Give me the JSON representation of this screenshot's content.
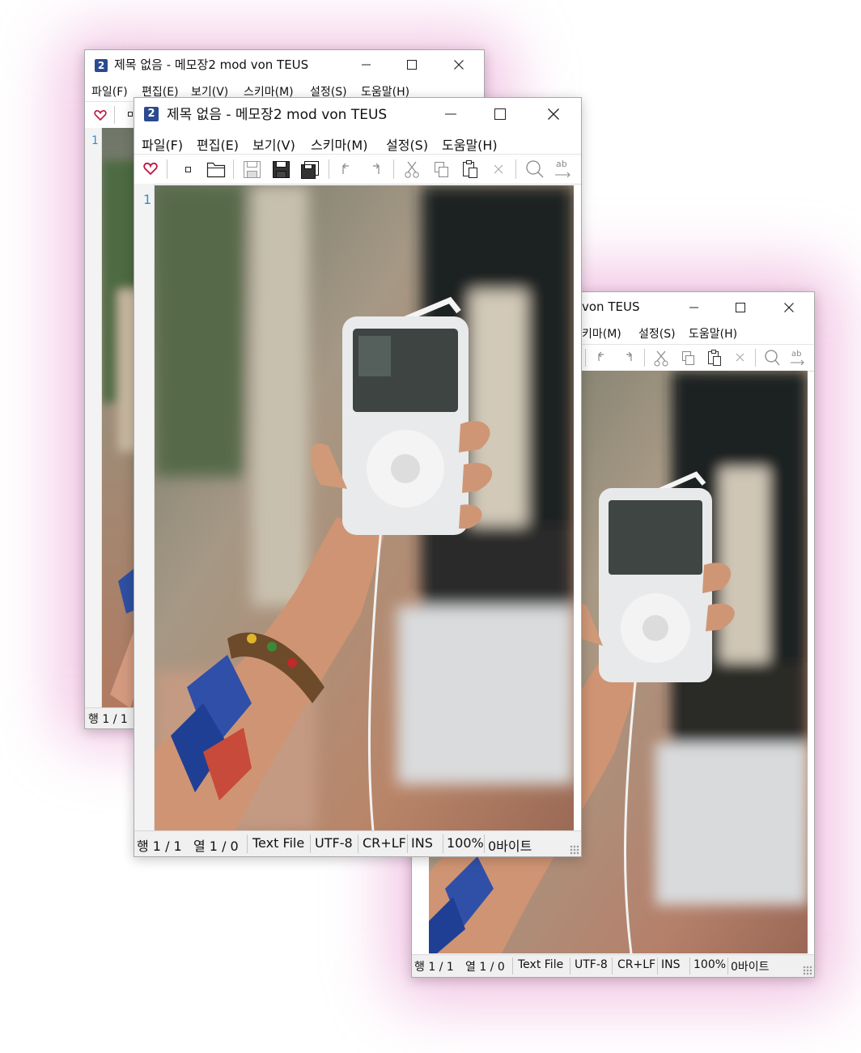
{
  "window": {
    "title": "제목 없음 - 메모장2 mod von TEUS",
    "title_partial": "von TEUS",
    "app_icon_glyph": "2",
    "app_icon_color": "#2b4a8f",
    "minimize_icon": "minimize-icon",
    "maximize_icon": "maximize-icon",
    "close_icon": "close-icon"
  },
  "menu": {
    "file": "파일(F)",
    "edit": "편집(E)",
    "view": "보기(V)",
    "scheme": "스키마(M)",
    "scheme_partial": "키마(M)",
    "settings": "설정(S)",
    "help": "도움말(H)"
  },
  "toolbar": {
    "icons": [
      "favorite-icon",
      "new-icon",
      "open-icon",
      "save-disabled-icon",
      "save-icon",
      "save-as-icon",
      "undo-icon",
      "redo-icon",
      "cut-icon",
      "copy-icon",
      "paste-icon",
      "delete-icon",
      "find-icon",
      "replace-icon"
    ],
    "accent_color": "#c0143c"
  },
  "editor": {
    "line_number": "1"
  },
  "status": {
    "row": "행 1 / 1",
    "col": "열 1 / 0",
    "type": "Text File",
    "encoding": "UTF-8",
    "line_ending": "CR+LF",
    "mode": "INS",
    "zoom": "100%",
    "size": "0바이트"
  }
}
